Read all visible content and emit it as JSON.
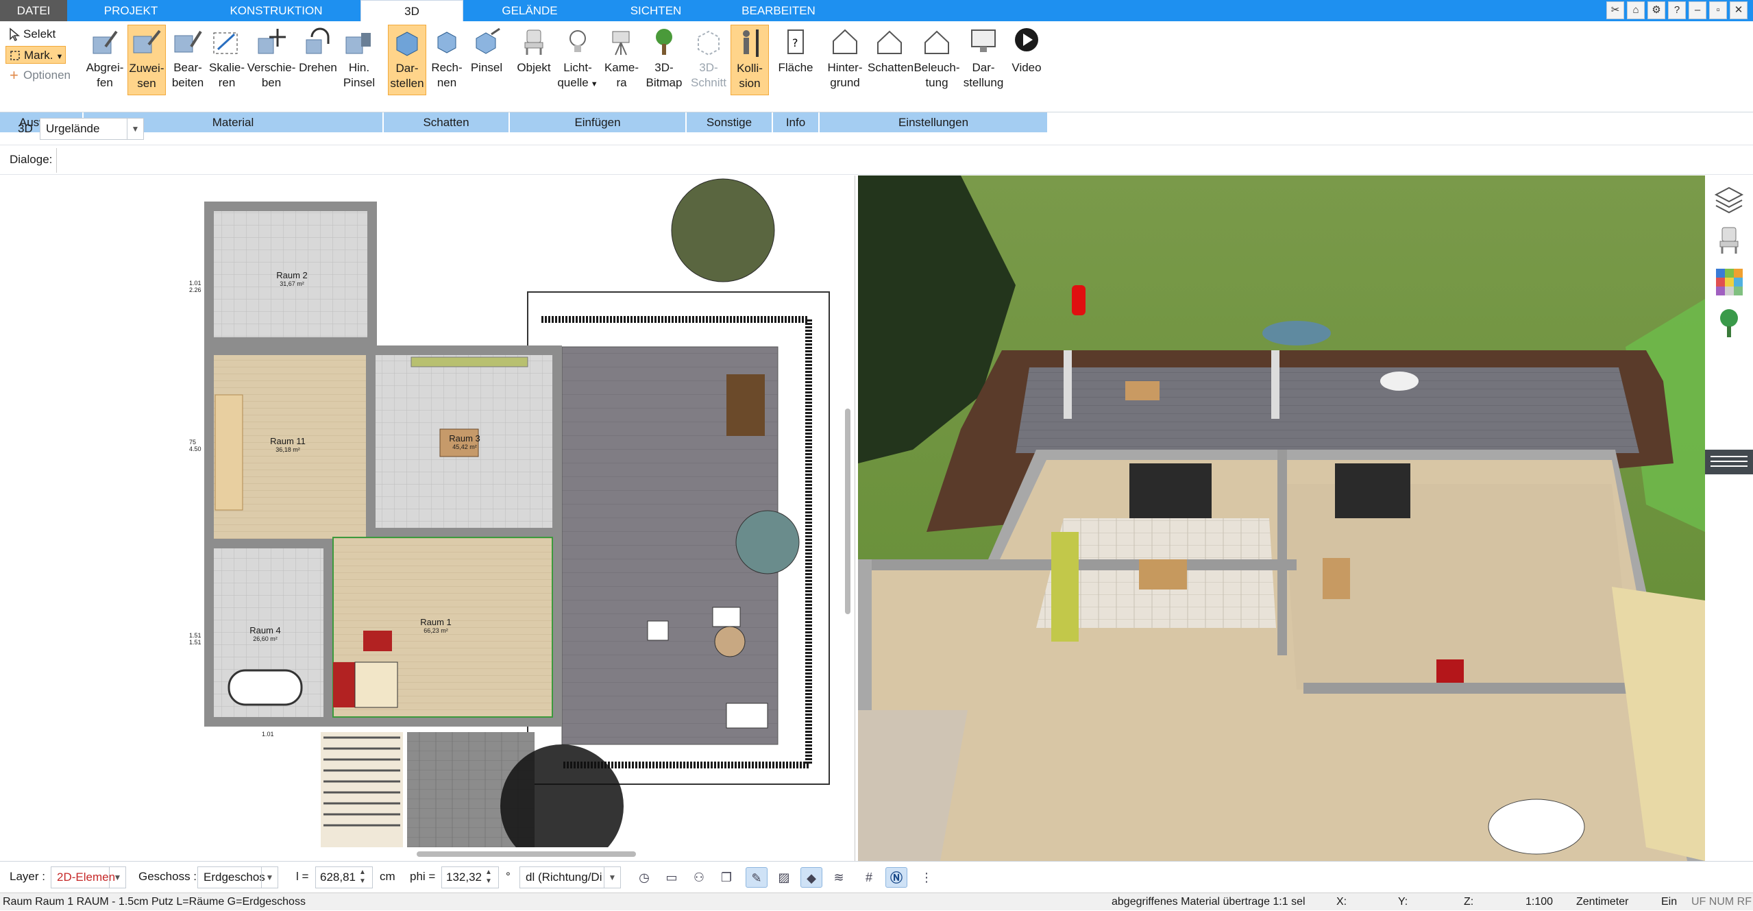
{
  "menu": {
    "tabs": [
      "DATEI",
      "PROJEKT",
      "KONSTRUKTION",
      "3D",
      "GELÄNDE",
      "SICHTEN",
      "BEARBEITEN"
    ],
    "active": "3D"
  },
  "window_controls": [
    "minimize",
    "restore",
    "close"
  ],
  "ribbon": {
    "auswahl": {
      "selekt": "Selekt",
      "mark": "Mark.",
      "optionen": "Optionen",
      "group": "Auswahl"
    },
    "material": {
      "group": "Material",
      "buttons": [
        {
          "l1": "Abgrei-",
          "l2": "fen"
        },
        {
          "l1": "Zuwei-",
          "l2": "sen"
        },
        {
          "l1": "Bear-",
          "l2": "beiten"
        },
        {
          "l1": "Skalie-",
          "l2": "ren"
        },
        {
          "l1": "Verschie-",
          "l2": "ben"
        },
        {
          "l1": "Drehen",
          "l2": ""
        },
        {
          "l1": "Hin.",
          "l2": "Pinsel"
        }
      ]
    },
    "schatten": {
      "group": "Schatten",
      "buttons": [
        {
          "l1": "Dar-",
          "l2": "stellen"
        },
        {
          "l1": "Rech-",
          "l2": "nen"
        },
        {
          "l1": "Pinsel",
          "l2": ""
        }
      ]
    },
    "einfuegen": {
      "group": "Einfügen",
      "buttons": [
        {
          "l1": "Objekt",
          "l2": ""
        },
        {
          "l1": "Licht-",
          "l2": "quelle"
        },
        {
          "l1": "Kame-",
          "l2": "ra"
        },
        {
          "l1": "3D-",
          "l2": "Bitmap"
        }
      ]
    },
    "sonstige": {
      "group": "Sonstige",
      "buttons": [
        {
          "l1": "3D-",
          "l2": "Schnitt"
        },
        {
          "l1": "Kolli-",
          "l2": "sion"
        }
      ]
    },
    "info": {
      "group": "Info",
      "buttons": [
        {
          "l1": "Fläche",
          "l2": ""
        }
      ]
    },
    "einstellungen": {
      "group": "Einstellungen",
      "buttons": [
        {
          "l1": "Hinter-",
          "l2": "grund"
        },
        {
          "l1": "Schatten",
          "l2": ""
        },
        {
          "l1": "Beleuch-",
          "l2": "tung"
        },
        {
          "l1": "Dar-",
          "l2": "stellung"
        },
        {
          "l1": "Video",
          "l2": ""
        }
      ]
    }
  },
  "toolbar": {
    "mode_label": "3D",
    "terrain_value": "Urgelände",
    "dialoge_label": "Dialoge:"
  },
  "plan": {
    "rooms": [
      {
        "name": "Raum 2",
        "area": "31,67 m²"
      },
      {
        "name": "Raum 11",
        "area": "36,18 m²"
      },
      {
        "name": "Raum 3",
        "area": "45,42 m²"
      },
      {
        "name": "Raum 4",
        "area": "26,60 m²"
      },
      {
        "name": "Raum 1",
        "area": "66,23 m²"
      }
    ],
    "dims": [
      "1.01",
      "2.26",
      "75",
      "4.50",
      "1.51",
      "1.51",
      "1.01"
    ]
  },
  "bottombar": {
    "layer_label": "Layer :",
    "layer_value": "2D-Elemen",
    "geschoss_label": "Geschoss :",
    "geschoss_value": "Erdgeschos",
    "l_label": "l =",
    "l_value": "628,81",
    "l_unit": "cm",
    "phi_label": "phi =",
    "phi_value": "132,32",
    "phi_unit": "°",
    "dl_value": "dl (Richtung/Di"
  },
  "status": {
    "left": "Raum Raum 1 RAUM - 1.5cm Putz L=Räume G=Erdgeschoss",
    "message": "abgegriffenes Material übertrage 1:1 sel",
    "x": "X:",
    "y": "Y:",
    "z": "Z:",
    "scale": "1:100",
    "unit": "Zentimeter",
    "ein": "Ein",
    "flags": "UF NUM RF"
  },
  "colors": {
    "menubar": "#1e90f0",
    "ribbon_group": "#a4cdf2",
    "selected_button": "#ffd48a",
    "lawn": "#6f9e3c",
    "floor_wood": "#d9c7a6",
    "terrace": "#7a7a80"
  },
  "right_icons": [
    "layers-icon",
    "chair-icon",
    "material-palette-icon",
    "tree-icon"
  ]
}
